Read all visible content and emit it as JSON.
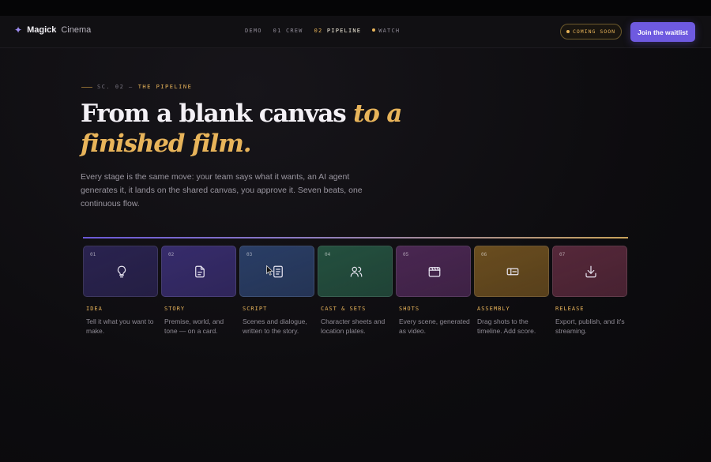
{
  "brand": {
    "name_bold": "Magick",
    "name_light": "Cinema",
    "star": "✦"
  },
  "nav": {
    "links": [
      {
        "num": "",
        "label": "DEMO"
      },
      {
        "num": "01",
        "label": "CREW"
      },
      {
        "num": "02",
        "label": "PIPELINE"
      },
      {
        "num": "",
        "label": "WATCH"
      }
    ],
    "active_index": 2,
    "coming_soon": "COMING SOON",
    "cta": "Join the waitlist"
  },
  "hero": {
    "eyebrow_prefix": "SC. 02 —",
    "eyebrow_label": "THE PIPELINE",
    "headline_plain": "From a blank canvas",
    "headline_accent": "to a finished film.",
    "lede": "Every stage is the same move: your team says what it wants, an AI agent generates it, it lands on the shared canvas, you approve it. Seven beats, one continuous flow."
  },
  "stages": [
    {
      "num": "01",
      "title": "IDEA",
      "desc": "Tell it what you want to make.",
      "icon": "lightbulb-icon",
      "color": "#2a2350"
    },
    {
      "num": "02",
      "title": "STORY",
      "desc": "Premise, world, and tone — on a card.",
      "icon": "document-icon",
      "color": "#372c6c"
    },
    {
      "num": "03",
      "title": "SCRIPT",
      "desc": "Scenes and dialogue, written to the story.",
      "icon": "script-icon",
      "color": "#2a3e66"
    },
    {
      "num": "04",
      "title": "CAST & SETS",
      "desc": "Character sheets and location plates.",
      "icon": "users-icon",
      "color": "#24503f"
    },
    {
      "num": "05",
      "title": "SHOTS",
      "desc": "Every scene, generated as video.",
      "icon": "clapperboard-icon",
      "color": "#4a2752"
    },
    {
      "num": "06",
      "title": "ASSEMBLY",
      "desc": "Drag shots to the timeline. Add score.",
      "icon": "timeline-icon",
      "color": "#6a4d1f"
    },
    {
      "num": "07",
      "title": "RELEASE",
      "desc": "Export, publish, and it's streaming.",
      "icon": "download-icon",
      "color": "#56283a"
    }
  ]
}
